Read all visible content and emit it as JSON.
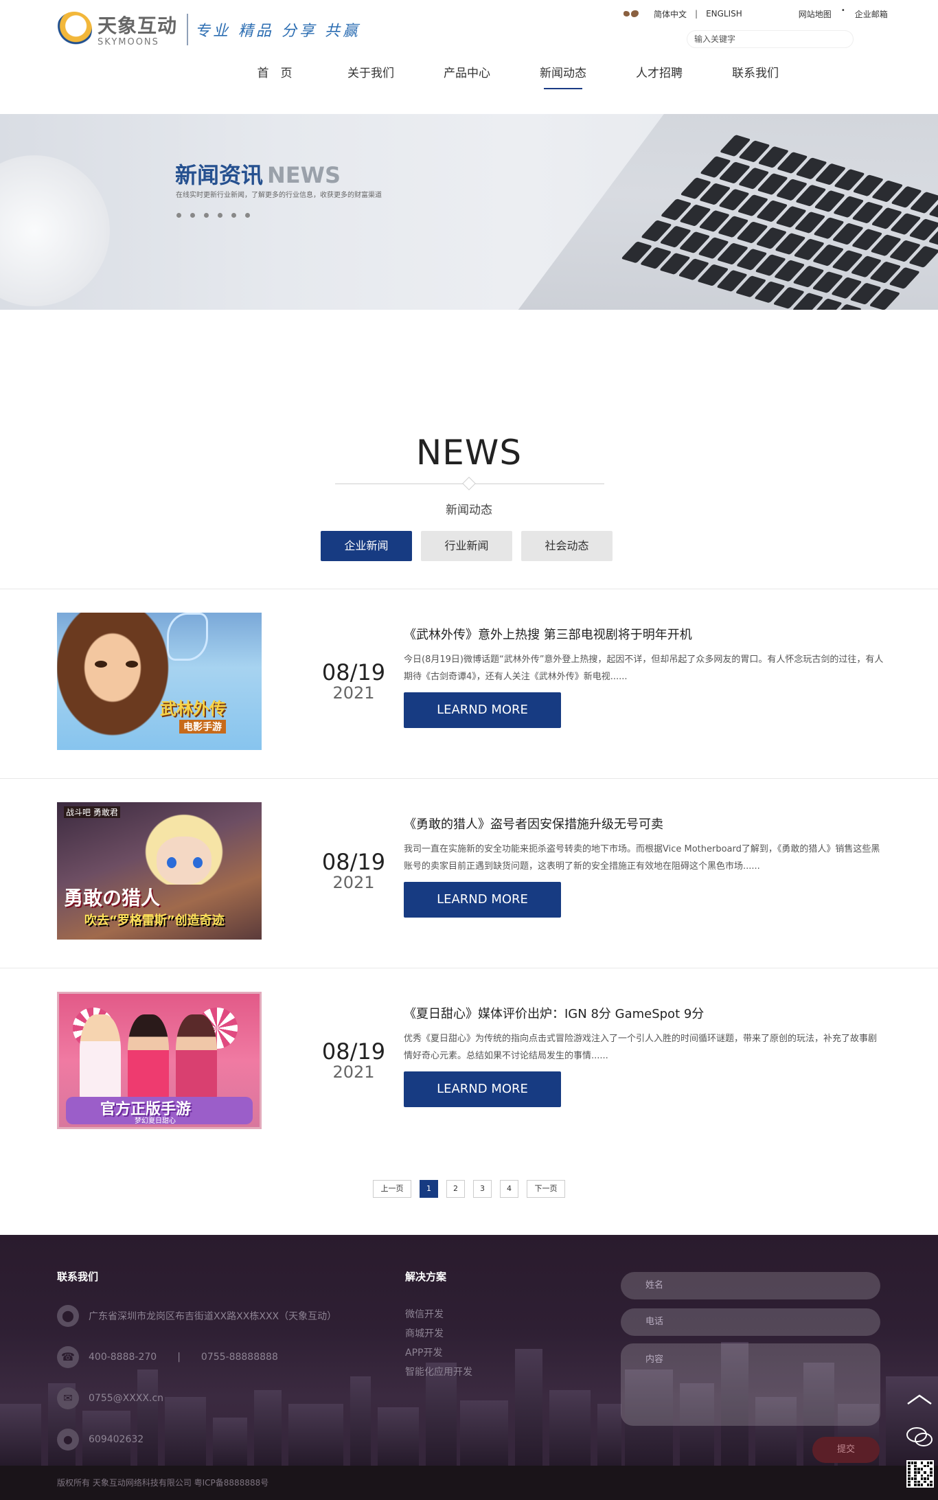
{
  "header": {
    "logo_cn": "天象互动",
    "logo_en": "SKYMOONS",
    "slogan": "专业 精品 分享 共赢",
    "lang_cn": "简体中文",
    "lang_en": "ENGLISH",
    "sitemap": "网站地图",
    "mail": "企业邮箱",
    "search_placeholder": "输入关键字",
    "nav": [
      "首　页",
      "关于我们",
      "产品中心",
      "新闻动态",
      "人才招聘",
      "联系我们"
    ],
    "nav_active_index": 3
  },
  "banner": {
    "title_cn": "新闻资讯",
    "title_en": "NEWS",
    "subtitle": "在线实时更新行业新闻，了解更多的行业信息，收获更多的财富渠道"
  },
  "news_section": {
    "title": "NEWS",
    "subtitle": "新闻动态",
    "tabs": [
      "企业新闻",
      "行业新闻",
      "社会动态"
    ],
    "active_tab": 0
  },
  "items": [
    {
      "date_md": "08/19",
      "date_y": "2021",
      "title": "《武林外传》意外上热搜 第三部电视剧将于明年开机",
      "desc": "今日(8月19日)微博话题“武林外传”意外登上热搜，起因不详，但却吊起了众多网友的胃口。有人怀念玩古剑的过往，有人期待《古剑奇谭4》，还有人关注《武林外传》新电视......",
      "more": "LEARND MORE",
      "thumb_text": "武林外传",
      "thumb_sub": "电影手游"
    },
    {
      "date_md": "08/19",
      "date_y": "2021",
      "title": "《勇敢的猎人》盗号者因安保措施升级无号可卖",
      "desc": "我司一直在实施新的安全功能来扼杀盗号转卖的地下市场。而根据Vice Motherboard了解到，《勇敢的猎人》销售这些黑账号的卖家目前正遇到缺货问题，这表明了新的安全措施正有效地在阻碍这个黑色市场......",
      "more": "LEARND MORE",
      "thumb_text": "勇敢の猎人",
      "thumb_sub": "吹去“罗格雷斯”创造奇迹",
      "thumb_logo": "战斗吧 勇敢君"
    },
    {
      "date_md": "08/19",
      "date_y": "2021",
      "title": "《夏日甜心》媒体评价出炉：IGN 8分 GameSpot 9分",
      "desc": "优秀《夏日甜心》为传统的指向点击式冒险游戏注入了一个引人入胜的时间循环谜题，带来了原创的玩法，补充了故事剧情好奇心元素。总结如果不讨论结局发生的事情......",
      "more": "LEARND MORE",
      "thumb_text": "官方正版手游",
      "thumb_sub": "梦幻夏日甜心"
    }
  ],
  "pagination": {
    "prev": "上一页",
    "pages": [
      "1",
      "2",
      "3",
      "4"
    ],
    "active": "1",
    "next": "下一页"
  },
  "footer": {
    "contact_title": "联系我们",
    "address": "广东省深圳市龙岗区布吉街道XX路XX栋XXX（天象互动）",
    "phone1": "400-8888-270",
    "phone_sep": "|",
    "phone2": "0755-88888888",
    "email": "0755@XXXX.cn",
    "qq": "609402632",
    "solutions_title": "解决方案",
    "solutions": [
      "微信开发",
      "商城开发",
      "APP开发",
      "智能化应用开发"
    ],
    "form_name": "姓名",
    "form_phone": "电话",
    "form_content": "内容",
    "form_submit": "提交",
    "copyright": "版权所有 天象互动网络科技有限公司 粤ICP备8888888号"
  }
}
